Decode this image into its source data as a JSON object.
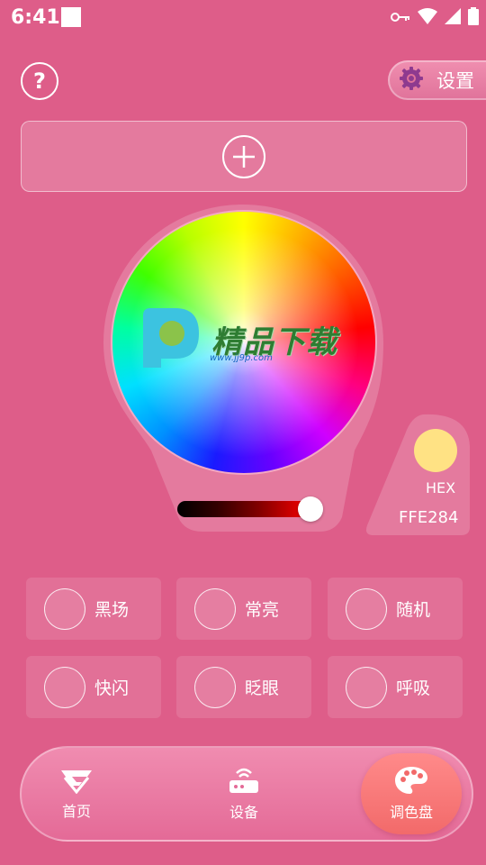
{
  "status_bar": {
    "time": "6:41",
    "icons": [
      "key-icon",
      "wifi-icon",
      "cellular-icon",
      "battery-icon"
    ]
  },
  "header": {
    "help_icon_text": "?",
    "settings_label": "设置",
    "settings_icon": "gear-icon"
  },
  "add_panel": {
    "icon": "plus-icon"
  },
  "color_picker": {
    "watermark_text": "精品下载",
    "watermark_url": "www.jj9p.com",
    "brightness_value": 1.0
  },
  "hex_panel": {
    "swatch_color": "#FFE284",
    "label": "HEX",
    "value": "FFE284"
  },
  "modes": [
    {
      "label": "黑场"
    },
    {
      "label": "常亮"
    },
    {
      "label": "随机"
    },
    {
      "label": "快闪"
    },
    {
      "label": "眨眼"
    },
    {
      "label": "呼吸"
    }
  ],
  "bottom_nav": {
    "items": [
      {
        "label": "首页",
        "icon": "home-logo-icon"
      },
      {
        "label": "设备",
        "icon": "router-icon"
      },
      {
        "label": "调色盘",
        "icon": "palette-icon"
      }
    ],
    "active_index": 2
  },
  "colors": {
    "background": "#de5d89",
    "accent_active": "#f26a6a",
    "hex_swatch": "#FFE284"
  }
}
